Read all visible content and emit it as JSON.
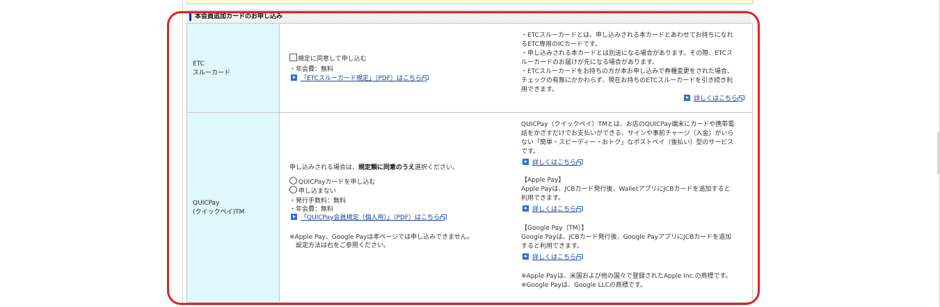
{
  "section": {
    "title": "本会員追加カードのお申し込み"
  },
  "etc": {
    "label_line1": "ETC",
    "label_line2": "スルーカード",
    "agree_checkbox_label": "規定に同意して申し込む",
    "fee": "・年会費：無料",
    "rules_link": "「ETCスルーカード規定」（PDF）はこちら",
    "desc": [
      "・ETCスルーカードとは、申し込みされる本カードとあわせてお持ちになれ",
      "るETC専用のICカードです。",
      "・申し込みされる本カードとは別送になる場合があります。その際、ETCス",
      "ルーカードのお届けが先になる場合があります。",
      "・ETCスルーカードをお持ちの方が本お申し込みで券種変更をされた場合、",
      "チェックの有無にかかわらず、現在お持ちのETCスルーカードを引き続き利",
      "用できます。"
    ],
    "details_link": "詳しくはこちら"
  },
  "quicpay": {
    "label_line1": "QUICPay",
    "label_line2": "(クイックペイ)TM",
    "intro_prefix": "申し込みされる場合は、",
    "intro_bold": "規定類に同意のうえ",
    "intro_suffix": "選択ください。",
    "option_apply": "QUICPayカードを申し込む",
    "option_decline": "申し込まない",
    "fee_issue": "・発行手数料：無料",
    "fee_annual": "・年会費：無料",
    "rules_link": "「QUICPay会員規定（個人用）」（PDF）はこちら",
    "note_line1": "※Apple Pay、Google Payは本ページでは申し込みできません。",
    "note_line2": "　設定方法は右をご参照ください。",
    "desc": [
      "QUICPay（クイックペイ）TMとは、お店のQUICPay端末にカードや携帯電",
      "話をかざすだけでお支払いができる、サインや事前チャージ（入金）がいら",
      "ない「簡単・スピーディー・おトク」なポストペイ（後払い）型のサービス",
      "です。"
    ],
    "details_link": "詳しくはこちら",
    "applepay_title": "【Apple Pay】",
    "applepay_desc": [
      "Apple Payは、JCBカード発行後、WalletアプリにJCBカードを追加すると",
      "利用できます。"
    ],
    "applepay_link": "詳しくはこちら",
    "googlepay_title": "【Google Pay（TM）】",
    "googlepay_desc": [
      "Google Payは、JCBカード発行後、Google PayアプリにJCBカードを追加",
      "すると利用できます。"
    ],
    "googlepay_link": "詳しくはこちら",
    "trademark_1": "※Apple Payは、米国および他の国々で登録されたApple Inc.の商標です。",
    "trademark_2": "※Google Payは、Google LLCの商標です。"
  },
  "colors": {
    "label_bg": "#dff8fb",
    "link": "#1a3fa3",
    "highlight_border": "#e41f24"
  }
}
